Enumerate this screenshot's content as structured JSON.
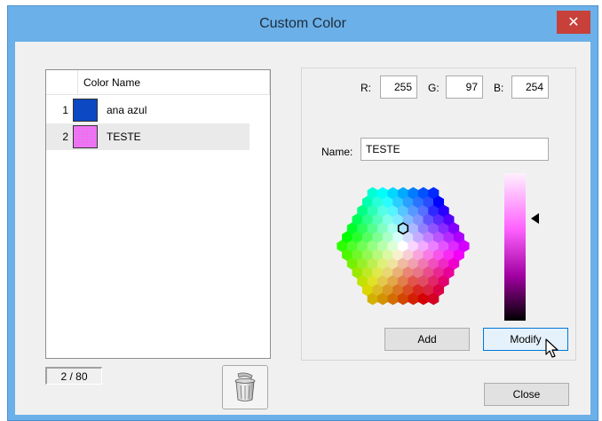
{
  "window": {
    "title": "Custom Color",
    "close_glyph": "✕"
  },
  "list": {
    "header": "Color Name",
    "rows": [
      {
        "num": "1",
        "name": "ana azul",
        "color": "#0b48c2"
      },
      {
        "num": "2",
        "name": "TESTE",
        "color": "#ff61fe"
      }
    ],
    "counter": "2 / 80"
  },
  "rgb": {
    "r_label": "R:",
    "r_value": "255",
    "g_label": "G:",
    "g_value": "97",
    "b_label": "B:",
    "b_value": "254"
  },
  "name_field": {
    "label": "Name:",
    "value": "TESTE"
  },
  "buttons": {
    "add": "Add",
    "modify": "Modify",
    "close": "Close"
  },
  "icons": {
    "delete": "trash-can-icon",
    "close": "close-icon",
    "cursor": "mouse-pointer-icon"
  },
  "colors": {
    "title_bar": "#6bb0e8",
    "close_button": "#c7403a",
    "selected_swatch": "#ff61fe"
  }
}
